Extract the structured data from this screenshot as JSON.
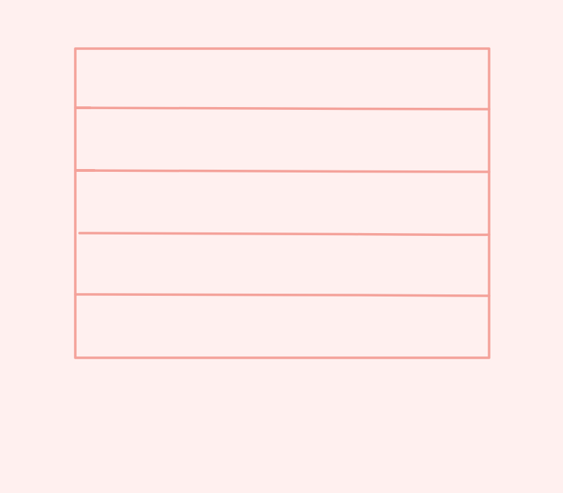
{
  "colors": {
    "background": "#fff0ef",
    "stroke": "#f4a29a"
  },
  "diagram": {
    "type": "stacked-rows-box",
    "row_count": 5
  }
}
